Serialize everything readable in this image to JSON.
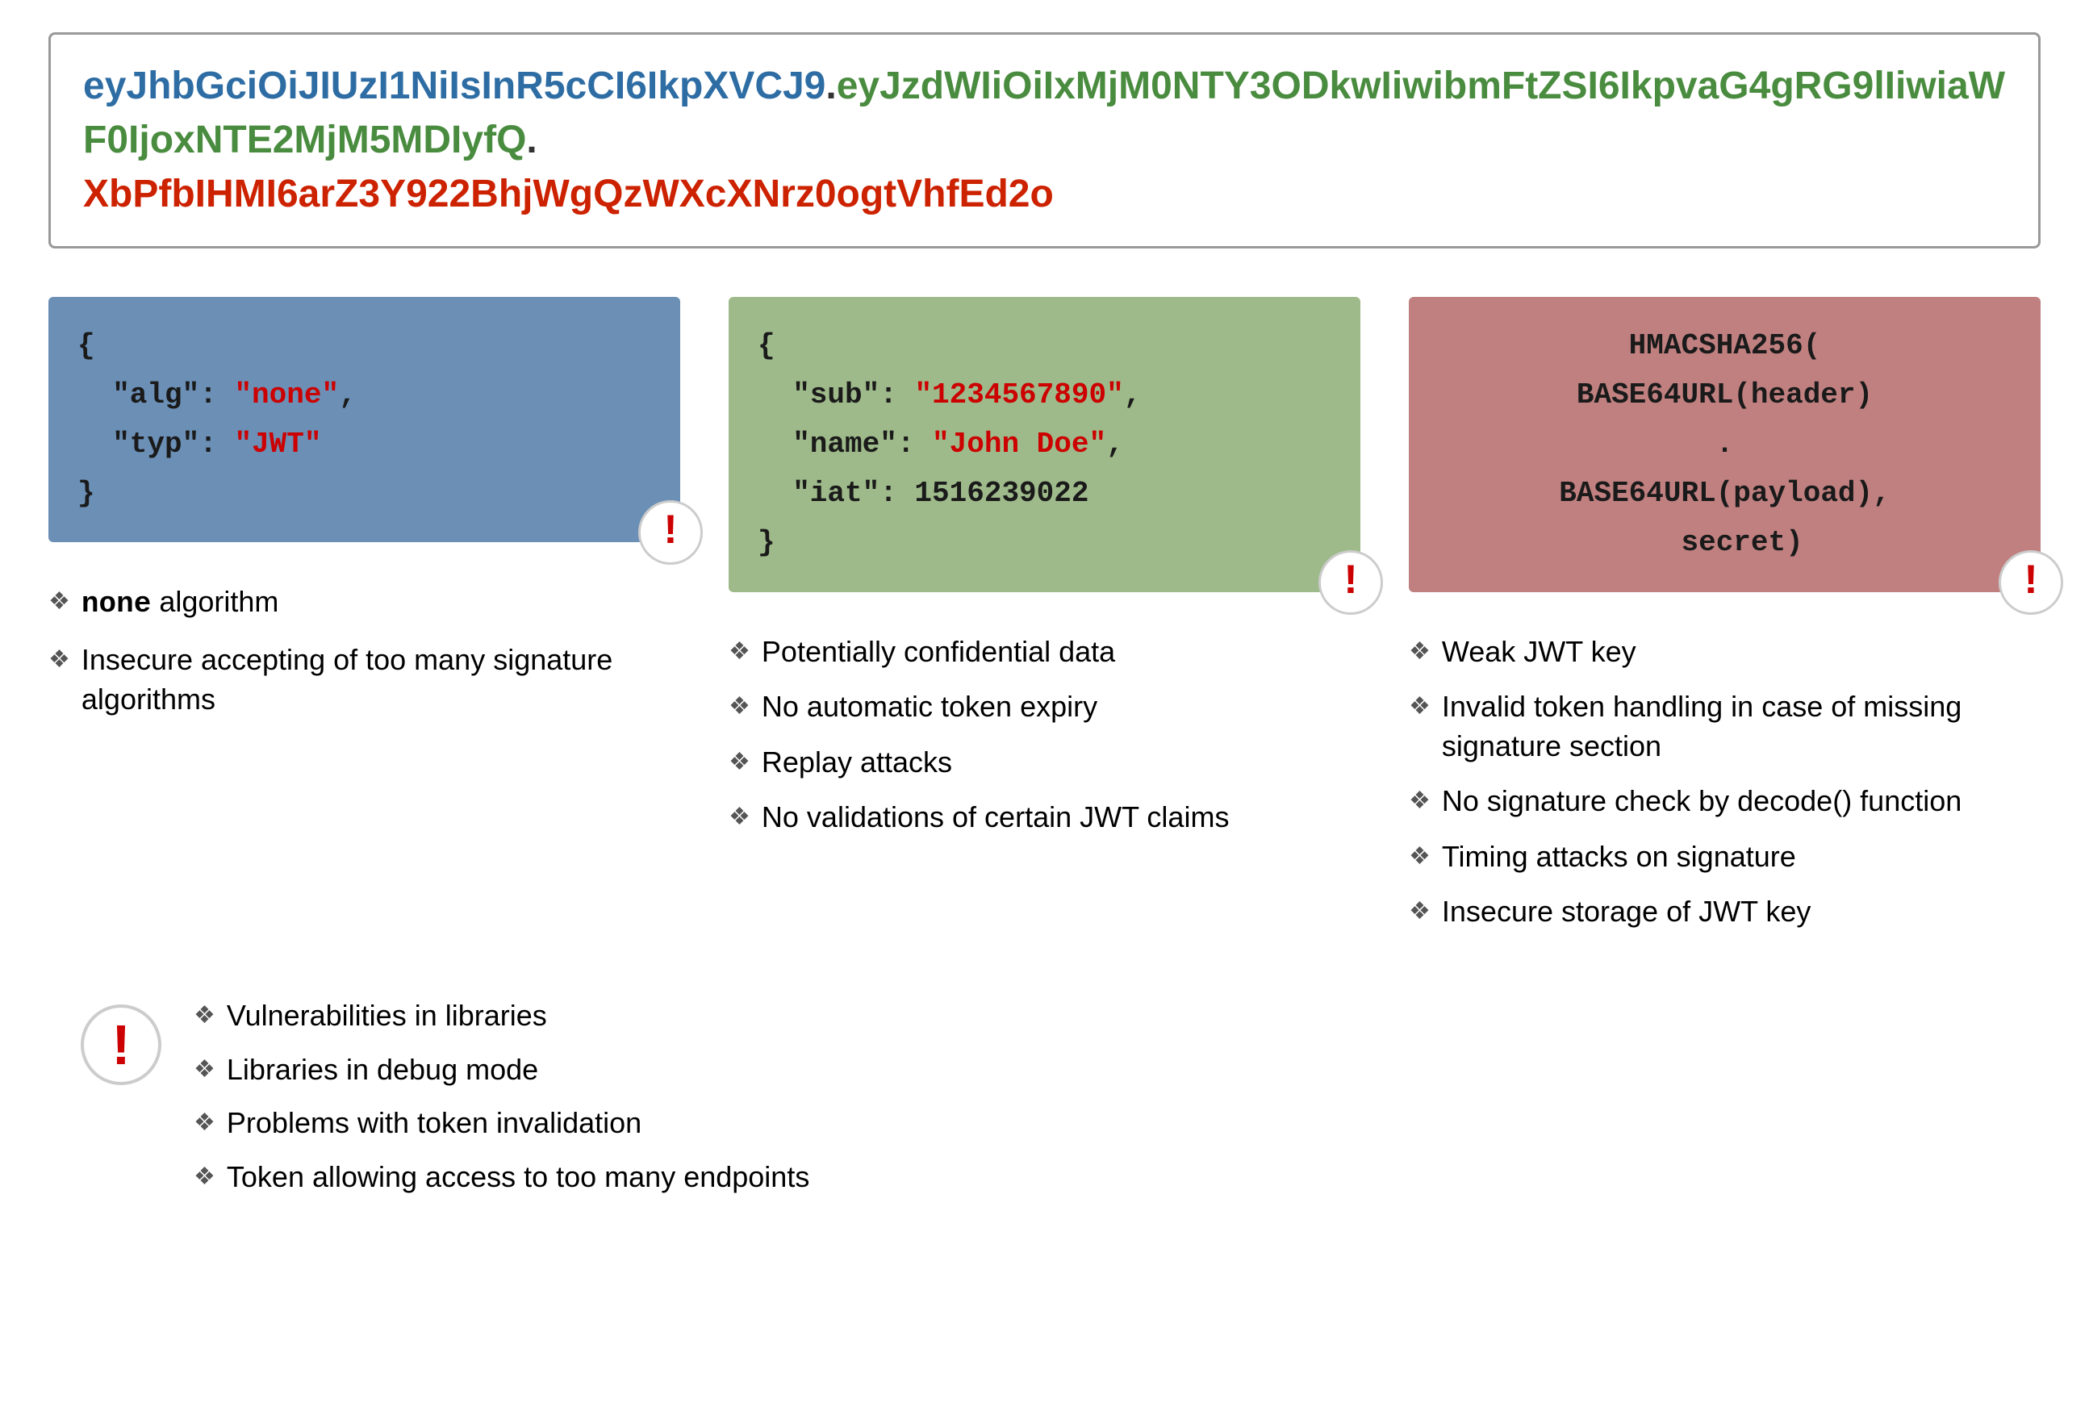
{
  "jwt": {
    "header": "eyJhbGciOiJIUzI1NiIsInR5cCI6IkpXVCJ9",
    "dot1": ".",
    "payload": "eyJzdWIiOiIxMjM0NTY3ODkwIiwibmFtZSI6IkpvaG4gRG9lIiwiaWF0IjoxNTE2MjM5MDIyfQ",
    "dot2": ".",
    "signature": "XbPfbIHMI6arZ3Y922BhjWgQzWXcXNrz0ogtVhfEd2o"
  },
  "col1": {
    "code_lines": [
      "{",
      "  \"alg\": \"none\",",
      "  \"typ\": \"JWT\"",
      "}"
    ],
    "bullets": [
      "none algorithm",
      "Insecure accepting of too many signature algorithms"
    ]
  },
  "col2": {
    "code_lines": [
      "{",
      "  \"sub\": \"1234567890\",",
      "  \"name\": \"John Doe\",",
      "  \"iat\": 1516239022",
      "}"
    ],
    "bullets": [
      "Potentially confidential data",
      "No automatic token expiry",
      "Replay attacks",
      "No validations of certain JWT claims"
    ]
  },
  "col3": {
    "code_lines": [
      "HMACSHA256(",
      "BASE64URL(header)",
      ".",
      "BASE64URL(payload),",
      "secret)"
    ],
    "bullets": [
      "Weak JWT key",
      "Invalid token handling in case of missing signature section",
      "No signature check by decode() function",
      "Timing attacks on signature",
      "Insecure storage of JWT key"
    ]
  },
  "bottom": {
    "bullets": [
      "Vulnerabilities in libraries",
      "Libraries in debug mode",
      "Problems with token invalidation",
      "Token allowing access to too many endpoints"
    ]
  }
}
